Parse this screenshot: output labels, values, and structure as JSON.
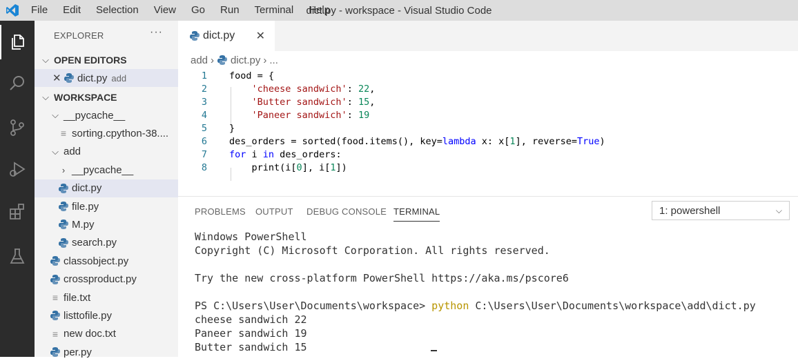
{
  "window": {
    "title": "dict.py - workspace - Visual Studio Code",
    "menu": [
      "File",
      "Edit",
      "Selection",
      "View",
      "Go",
      "Run",
      "Terminal",
      "Help"
    ]
  },
  "activity_icons": [
    "explorer-icon",
    "search-icon",
    "source-control-icon",
    "run-debug-icon",
    "extensions-icon",
    "testing-icon"
  ],
  "sidebar": {
    "header": "EXPLORER",
    "more": "···",
    "open_editors_label": "OPEN EDITORS",
    "open_editor": {
      "name": "dict.py",
      "desc": "add"
    },
    "workspace_label": "WORKSPACE",
    "tree": [
      {
        "name": "__pycache__",
        "type": "folder-open",
        "indent": 1
      },
      {
        "name": "sorting.cpython-38....",
        "type": "file-txt",
        "indent": 2
      },
      {
        "name": "add",
        "type": "folder-open",
        "indent": 1
      },
      {
        "name": "__pycache__",
        "type": "folder-closed",
        "indent": 2
      },
      {
        "name": "dict.py",
        "type": "py",
        "indent": 2,
        "selected": true
      },
      {
        "name": "file.py",
        "type": "py",
        "indent": 2
      },
      {
        "name": "M.py",
        "type": "py",
        "indent": 2
      },
      {
        "name": "search.py",
        "type": "py",
        "indent": 2
      },
      {
        "name": "classobject.py",
        "type": "py",
        "indent": 1
      },
      {
        "name": "crossproduct.py",
        "type": "py",
        "indent": 1
      },
      {
        "name": "file.txt",
        "type": "file-txt",
        "indent": 1
      },
      {
        "name": "listtofile.py",
        "type": "py",
        "indent": 1
      },
      {
        "name": "new doc.txt",
        "type": "file-txt",
        "indent": 1
      },
      {
        "name": "per.py",
        "type": "py",
        "indent": 1
      }
    ]
  },
  "editor": {
    "tab_label": "dict.py",
    "breadcrumb": {
      "folder": "add",
      "file": "dict.py",
      "ellipsis": "..."
    },
    "line_numbers": [
      "1",
      "2",
      "3",
      "4",
      "5",
      "6",
      "7",
      "8"
    ],
    "code": {
      "l1": "food = {",
      "l2_key": "'cheese sandwich'",
      "l2_val": "22",
      "l3_key": "'Butter sandwich'",
      "l3_val": "15",
      "l4_key": "'Paneer sandwich'",
      "l4_val": "19",
      "l5": "}",
      "l6_a": "des_orders = sorted(food.items(), key=",
      "l6_kw": "lambda",
      "l6_b": " x: x[",
      "l6_n": "1",
      "l6_c": "], reverse=",
      "l6_true": "True",
      "l6_d": ")",
      "l7_for": "for",
      "l7_a": " i ",
      "l7_in": "in",
      "l7_b": " des_orders:",
      "l8_a": "    print(i[",
      "l8_n0": "0",
      "l8_b": "], i[",
      "l8_n1": "1",
      "l8_c": "])"
    }
  },
  "panel": {
    "tabs": [
      "PROBLEMS",
      "OUTPUT",
      "DEBUG CONSOLE",
      "TERMINAL"
    ],
    "active_tab": "TERMINAL",
    "terminal_select": "1: powershell",
    "terminal": {
      "l1": "Windows PowerShell",
      "l2": "Copyright (C) Microsoft Corporation. All rights reserved.",
      "l3": "Try the new cross-platform PowerShell https://aka.ms/pscore6",
      "prompt": "PS C:\\Users\\User\\Documents\\workspace> ",
      "cmd": "python",
      "cmd_arg": " C:\\Users\\User\\Documents\\workspace\\add\\dict.py",
      "o1": "cheese sandwich 22",
      "o2": "Paneer sandwich 19",
      "o3": "Butter sandwich 15"
    }
  },
  "colors": {
    "keyword": "#0000ff",
    "string": "#a31515",
    "number": "#098658",
    "line_number": "#237893",
    "python_blue": "#3572a5"
  }
}
